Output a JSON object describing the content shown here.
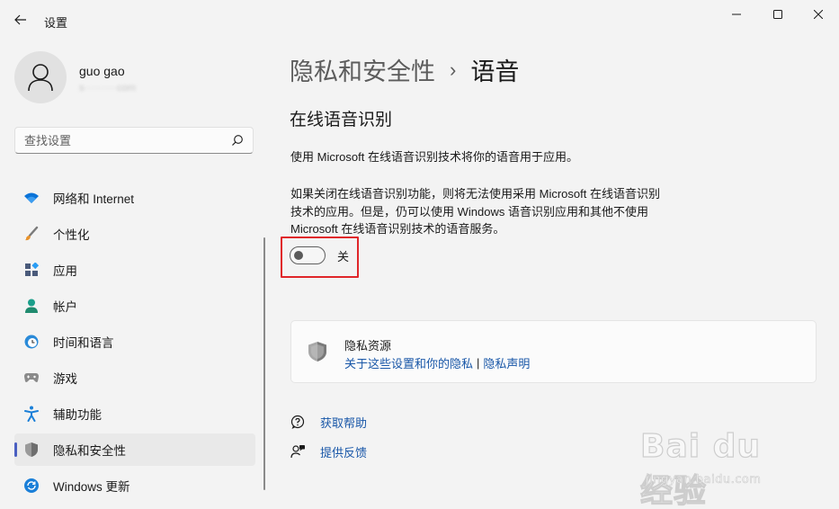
{
  "window": {
    "title": "设置"
  },
  "user": {
    "name": "guo gao",
    "email": "s··········com"
  },
  "search": {
    "placeholder": "查找设置"
  },
  "sidebar": {
    "items": [
      {
        "label": "网络和 Internet",
        "icon": "wifi-icon"
      },
      {
        "label": "个性化",
        "icon": "brush-icon"
      },
      {
        "label": "应用",
        "icon": "apps-icon"
      },
      {
        "label": "帐户",
        "icon": "account-icon"
      },
      {
        "label": "时间和语言",
        "icon": "clock-globe-icon"
      },
      {
        "label": "游戏",
        "icon": "gamepad-icon"
      },
      {
        "label": "辅助功能",
        "icon": "accessibility-icon"
      },
      {
        "label": "隐私和安全性",
        "icon": "shield-icon",
        "selected": true
      },
      {
        "label": "Windows 更新",
        "icon": "update-icon"
      }
    ]
  },
  "breadcrumb": {
    "parent": "隐私和安全性",
    "separator": "›",
    "current": "语音"
  },
  "section": {
    "title": "在线语音识别",
    "description": "使用 Microsoft 在线语音识别技术将你的语音用于应用。",
    "detail_lines": [
      "如果关闭在线语音识别功能，则将无法使用采用 Microsoft 在线语音识别",
      "技术的应用。但是，仍可以使用 Windows 语音识别应用和其他不使用",
      "Microsoft 在线语音识别技术的语音服务。"
    ],
    "toggle": {
      "state": "off",
      "label": "关"
    }
  },
  "privacy_card": {
    "title": "隐私资源",
    "link1": "关于这些设置和你的隐私",
    "separator": "|",
    "link2": "隐私声明"
  },
  "help": {
    "get_help": "获取帮助",
    "feedback": "提供反馈"
  },
  "watermark": {
    "main": "Bai du 经验",
    "sub": "jingyan.baidu.com"
  },
  "colors": {
    "accent": "#4a5fc1",
    "link": "#1957a8",
    "highlight": "#e0262a",
    "background": "#f3f3f3"
  }
}
